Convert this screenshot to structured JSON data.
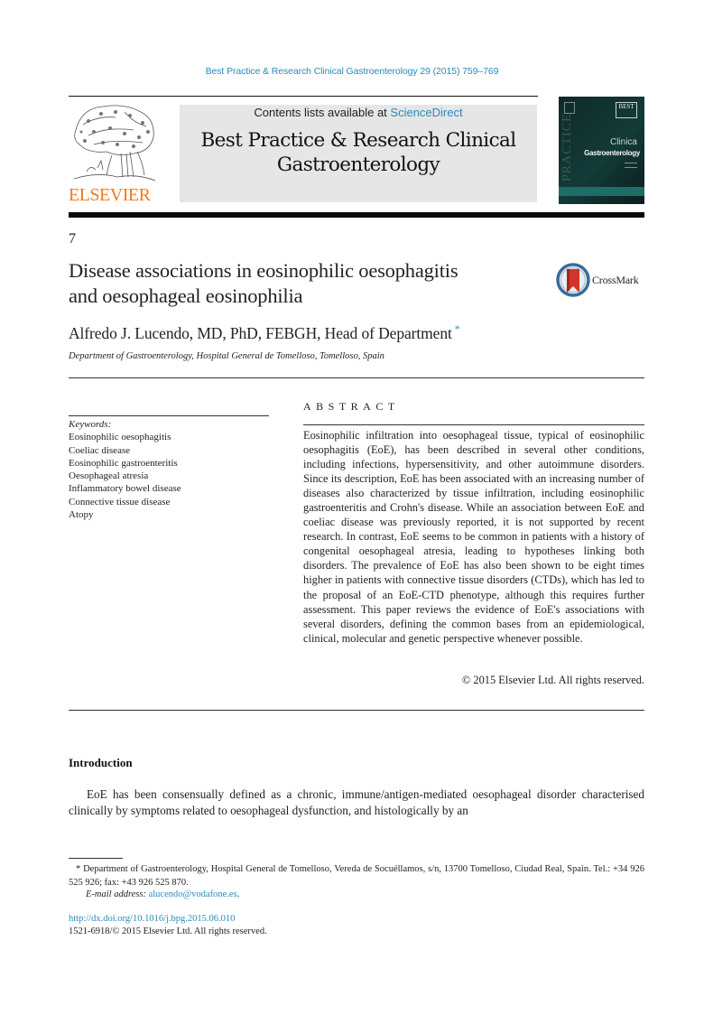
{
  "running_head": "Best Practice & Research Clinical Gastroenterology 29 (2015) 759–769",
  "publisher": {
    "logo_word": "ELSEVIER",
    "colors": {
      "brand_orange": "#f07a1a",
      "link_blue": "#2a8ab8",
      "masthead_gray": "#e6e6e6",
      "cover_teal": "#1e6d67"
    }
  },
  "masthead": {
    "contents_prefix": "Contents lists available at ",
    "contents_link": "ScienceDirect",
    "journal_line1": "Best Practice & Research Clinical",
    "journal_line2": "Gastroenterology"
  },
  "cover": {
    "best_label": "BEST",
    "practice_label": "PRACTICE",
    "clinical_label": "Clinica",
    "gastro_label": "Gastroenterology"
  },
  "article": {
    "number": "7",
    "title_line1": "Disease associations in eosinophilic oesophagitis",
    "title_line2": "and oesophageal eosinophilia",
    "crossmark_label": "CrossMark",
    "author": "Alfredo J. Lucendo, MD, PhD, FEBGH, Head of Department",
    "author_marker": "*",
    "affiliation": "Department of Gastroenterology, Hospital General de Tomelloso, Tomelloso, Spain"
  },
  "keywords": {
    "label": "Keywords:",
    "items": [
      "Eosinophilic oesophagitis",
      "Coeliac disease",
      "Eosinophilic gastroenteritis",
      "Oesophageal atresia",
      "Inflammatory bowel disease",
      "Connective tissue disease",
      "Atopy"
    ]
  },
  "abstract": {
    "heading": "ABSTRACT",
    "text": "Eosinophilic infiltration into oesophageal tissue, typical of eosin­ophilic oesophagitis (EoE), has been described in several other conditions, including infections, hypersensitivity, and other auto­immune disorders. Since its description, EoE has been associated with an increasing number of diseases also characterized by tissue infiltration, including eosinophilic gastroenteritis and Crohn's disease. While an association between EoE and coeliac disease was previously reported, it is not supported by recent research. In contrast, EoE seems to be common in patients with a history of congenital oesophageal atresia, leading to hypotheses linking both disorders. The prevalence of EoE has also been shown to be eight times higher in patients with connective tissue disorders (CTDs), which has led to the proposal of an EoE-CTD phenotype, although this requires further assessment. This paper reviews the evidence of EoE's associations with several disorders, defining the common bases from an epidemiological, clinical, molecular and genetic perspective whenever possible.",
    "copyright": "© 2015 Elsevier Ltd. All rights reserved."
  },
  "introduction": {
    "heading": "Introduction",
    "text": "EoE has been consensually defined as a chronic, immune/antigen-mediated oesophageal disorder characterised clinically by symptoms related to oesophageal dysfunction, and histologically by an"
  },
  "footnote": {
    "marker": "*",
    "text": "Department of Gastroenterology, Hospital General de Tomelloso, Vereda de Socuéllamos, s/n, 13700 Tomelloso, Ciudad Real, Spain. Tel.: +34 926 525 926; fax: +43 926 525 870.",
    "email_label": "E-mail address:",
    "email": "alucendo@vodafone.es",
    "email_suffix": ".",
    "doi": "http://dx.doi.org/10.1016/j.bpg.2015.06.010",
    "issn_line": "1521-6918/© 2015 Elsevier Ltd. All rights reserved."
  }
}
